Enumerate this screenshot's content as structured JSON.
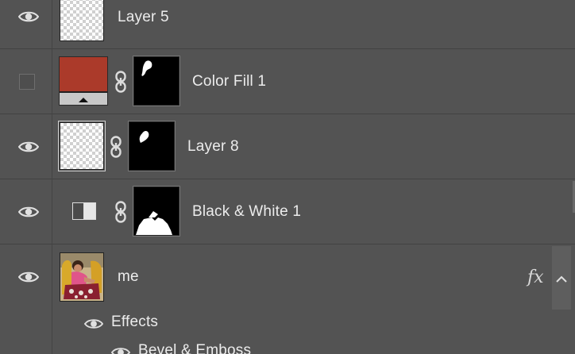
{
  "layers": [
    {
      "name": "Layer 5",
      "visible": true
    },
    {
      "name": "Color Fill 1",
      "visible": false,
      "fill_color": "#ab3a2a"
    },
    {
      "name": "Layer 8",
      "visible": true
    },
    {
      "name": "Black & White 1",
      "visible": true
    },
    {
      "name": "me",
      "visible": true,
      "fx_label": "fx"
    }
  ],
  "effects": {
    "label": "Effects",
    "items": [
      "Bevel & Emboss"
    ]
  },
  "icons": {
    "visibility": "eye-icon",
    "link": "chain-link-icon",
    "adjustment": "black-white-adjustment-icon",
    "collapse": "chevron-up-icon"
  }
}
